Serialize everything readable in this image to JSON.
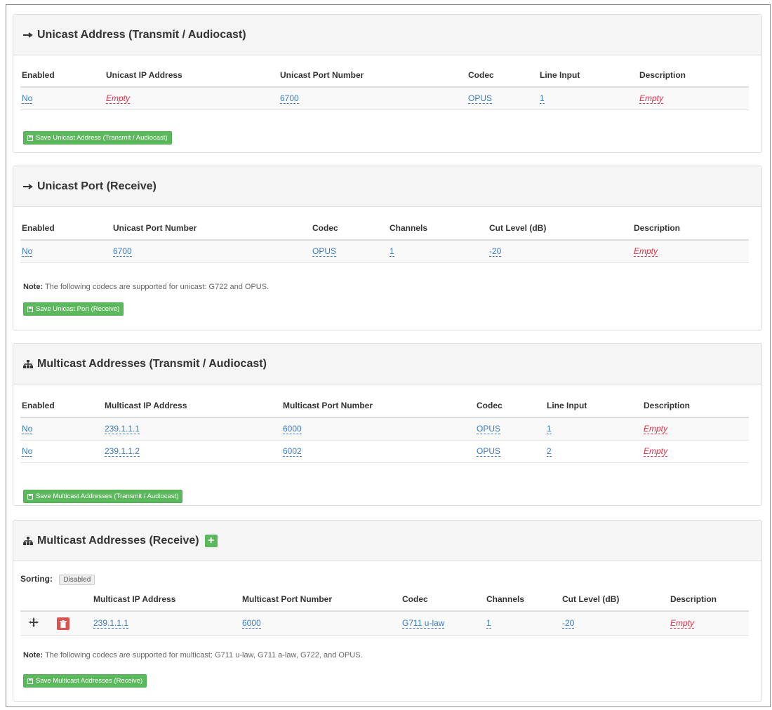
{
  "colors": {
    "link": "#3a7cc1",
    "empty": "#d9334a",
    "save_button": "#5cb85c",
    "delete_button": "#d9534f"
  },
  "unicast_tx": {
    "title": "Unicast Address (Transmit / Audiocast)",
    "headers": [
      "Enabled",
      "Unicast IP Address",
      "Unicast Port Number",
      "Codec",
      "Line Input",
      "Description"
    ],
    "row": {
      "enabled": "No",
      "ip": "Empty",
      "port": "6700",
      "codec": "OPUS",
      "line_input": "1",
      "description": "Empty"
    },
    "save_label": "Save Unicast Address (Transmit / Audiocast)"
  },
  "unicast_rx": {
    "title": "Unicast Port (Receive)",
    "headers": [
      "Enabled",
      "Unicast Port Number",
      "Codec",
      "Channels",
      "Cut Level (dB)",
      "Description"
    ],
    "row": {
      "enabled": "No",
      "port": "6700",
      "codec": "OPUS",
      "channels": "1",
      "cut_level": "-20",
      "description": "Empty"
    },
    "note_label": "Note:",
    "note_text": " The following codecs are supported for unicast: G722 and OPUS.",
    "save_label": "Save Unicast Port (Receive)"
  },
  "multicast_tx": {
    "title": "Multicast Addresses (Transmit / Audiocast)",
    "headers": [
      "Enabled",
      "Multicast IP Address",
      "Multicast Port Number",
      "Codec",
      "Line Input",
      "Description"
    ],
    "rows": [
      {
        "enabled": "No",
        "ip": "239.1.1.1",
        "port": "6000",
        "codec": "OPUS",
        "line_input": "1",
        "description": "Empty"
      },
      {
        "enabled": "No",
        "ip": "239.1.1.2",
        "port": "6002",
        "codec": "OPUS",
        "line_input": "2",
        "description": "Empty"
      }
    ],
    "save_label": "Save Multicast Addresses (Transmit / Audiocast)"
  },
  "multicast_rx": {
    "title": "Multicast Addresses (Receive)",
    "sorting_label": "Sorting:",
    "sorting_state": "Disabled",
    "headers": [
      "Multicast IP Address",
      "Multicast Port Number",
      "Codec",
      "Channels",
      "Cut Level (dB)",
      "Description"
    ],
    "row": {
      "ip": "239.1.1.1",
      "port": "6000",
      "codec": "G711 u-law",
      "channels": "1",
      "cut_level": "-20",
      "description": "Empty"
    },
    "note_label": "Note:",
    "note_text": " The following codecs are supported for multicast: G711 u-law, G711 a-law, G722, and OPUS.",
    "save_label": "Save Multicast Addresses (Receive)"
  }
}
